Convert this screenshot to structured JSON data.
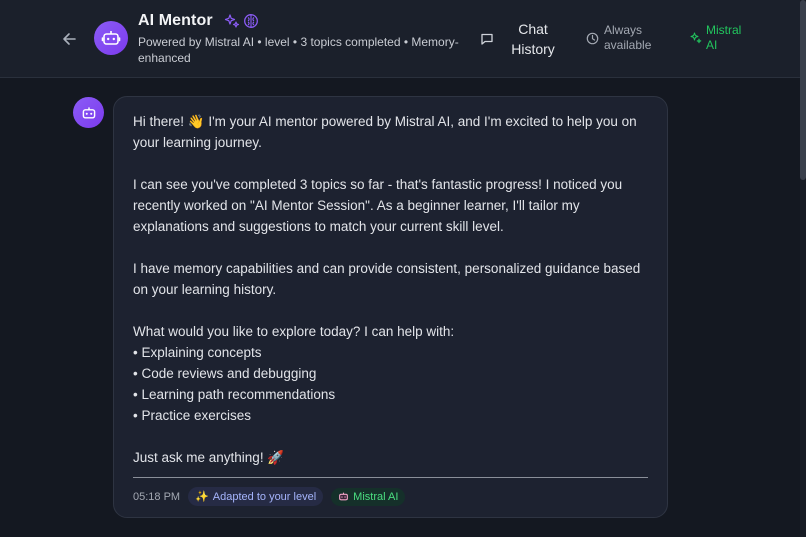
{
  "header": {
    "title": "AI Mentor",
    "subtitle": "Powered by Mistral AI • level • 3 topics completed • Memory-enhanced",
    "chat_history": "Chat History",
    "availability": "Always available",
    "provider": "Mistral AI"
  },
  "message": {
    "paragraphs": [
      "Hi there! 👋 I'm your AI mentor powered by Mistral AI, and I'm excited to help you on your learning journey.",
      "I can see you've completed 3 topics so far - that's fantastic progress! I noticed you recently worked on \"AI Mentor Session\". As a beginner learner, I'll tailor my explanations and suggestions to match your current skill level.",
      "I have memory capabilities and can provide consistent, personalized guidance based on your learning history.",
      "What would you like to explore today? I can help with:"
    ],
    "list": [
      "• Explaining concepts",
      "• Code reviews and debugging",
      "• Learning path recommendations",
      "• Practice exercises"
    ],
    "closing": "Just ask me anything! 🚀",
    "time": "05:18 PM",
    "badge_level": "Adapted to your level",
    "badge_provider": "Mistral AI"
  },
  "colors": {
    "accent": "#8b5cf6",
    "success": "#22c55e",
    "background": "#141821"
  }
}
